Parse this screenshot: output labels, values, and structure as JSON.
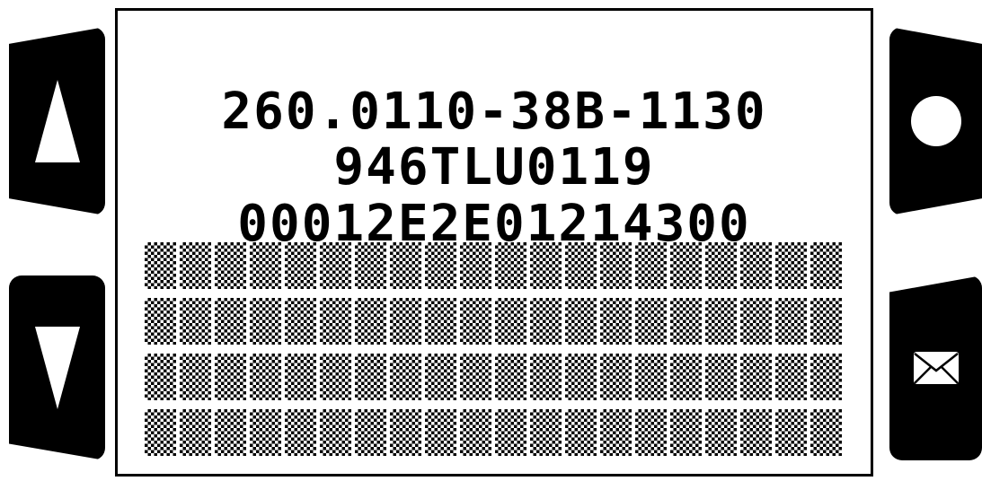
{
  "buttons": {
    "up": {
      "icon": "up-triangle-icon"
    },
    "down": {
      "icon": "down-triangle-icon"
    },
    "ok": {
      "icon": "circle-icon"
    },
    "message": {
      "icon": "envelope-icon"
    }
  },
  "display": {
    "lines": [
      "260.0110-38B-1130",
      "946TLU0119",
      "00012E2E01214300"
    ],
    "pixel_rows": 4,
    "pixel_cols": 20
  },
  "colors": {
    "foreground": "#000000",
    "background": "#ffffff"
  }
}
